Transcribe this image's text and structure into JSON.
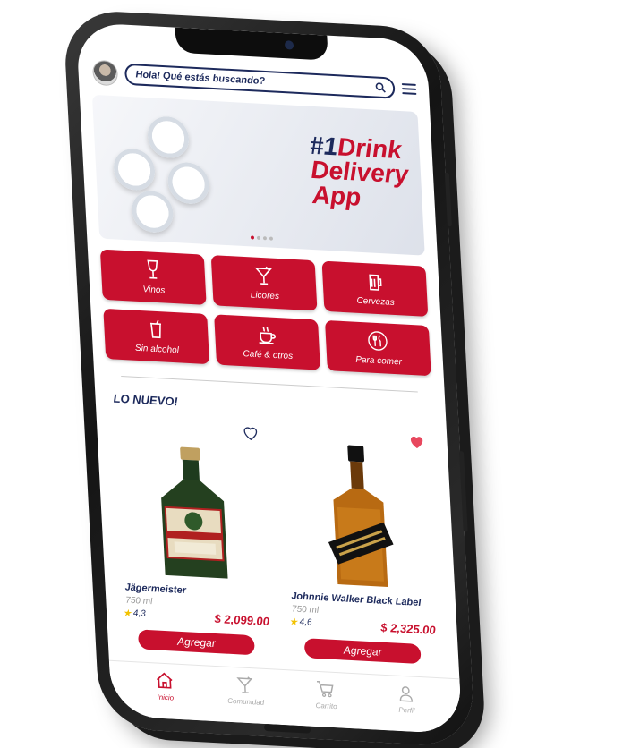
{
  "search": {
    "placeholder": "Hola! Qué estás buscando?"
  },
  "banner": {
    "line1_a": "#1",
    "line1_b": "Drink",
    "line2": "Delivery",
    "line3": "App",
    "slide_count": 4,
    "active_slide": 0
  },
  "categories": [
    {
      "label": "Vinos",
      "icon": "wine-glass-icon"
    },
    {
      "label": "Licores",
      "icon": "cocktail-icon"
    },
    {
      "label": "Cervezas",
      "icon": "beer-icon"
    },
    {
      "label": "Sin alcohol",
      "icon": "soda-cup-icon"
    },
    {
      "label": "Café & otros",
      "icon": "coffee-cup-icon"
    },
    {
      "label": "Para comer",
      "icon": "cutlery-icon"
    }
  ],
  "section": {
    "title": "LO NUEVO!"
  },
  "products": [
    {
      "name": "Jägermeister",
      "size": "750 ml",
      "rating": "4,3",
      "price": "$ 2,099.00",
      "favorite": false,
      "add_label": "Agregar"
    },
    {
      "name": "Johnnie Walker Black Label",
      "size": "750 ml",
      "rating": "4,6",
      "price": "$ 2,325.00",
      "favorite": true,
      "add_label": "Agregar"
    }
  ],
  "tabs": [
    {
      "label": "Inicio",
      "icon": "home-icon",
      "active": true
    },
    {
      "label": "Comunidad",
      "icon": "cocktail-icon",
      "active": false
    },
    {
      "label": "Carrito",
      "icon": "cart-icon",
      "active": false
    },
    {
      "label": "Perfil",
      "icon": "user-icon",
      "active": false
    }
  ],
  "colors": {
    "brand_red": "#c8102e",
    "brand_navy": "#1d2a5c",
    "star": "#f2c200"
  }
}
